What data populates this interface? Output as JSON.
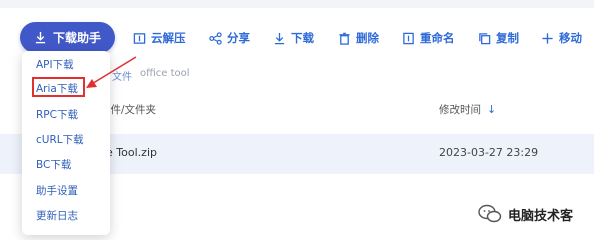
{
  "toolbar": {
    "main_button": "下载助手",
    "items": [
      {
        "label": "云解压",
        "icon": "archive-icon"
      },
      {
        "label": "分享",
        "icon": "share-icon"
      },
      {
        "label": "下载",
        "icon": "download-icon"
      },
      {
        "label": "删除",
        "icon": "trash-icon"
      },
      {
        "label": "重命名",
        "icon": "rename-icon"
      },
      {
        "label": "复制",
        "icon": "copy-icon"
      },
      {
        "label": "移动",
        "icon": "plus-icon"
      }
    ]
  },
  "breadcrumb": {
    "parent": "文件",
    "current": "office tool"
  },
  "list": {
    "header_name": "文件/文件夹",
    "header_time": "修改时间",
    "rows": [
      {
        "name": "ce Tool.zip",
        "time": "2023-03-27 23:29"
      }
    ]
  },
  "dropdown": {
    "items": [
      "API下载",
      "Aria下载",
      "RPC下载",
      "cURL下载",
      "BC下载",
      "助手设置",
      "更新日志"
    ],
    "highlighted": "Aria下载"
  },
  "watermark": {
    "text": "电脑技术客"
  },
  "colors": {
    "accent": "#2f6bd8",
    "button": "#4158c8",
    "highlight": "#e03030"
  }
}
